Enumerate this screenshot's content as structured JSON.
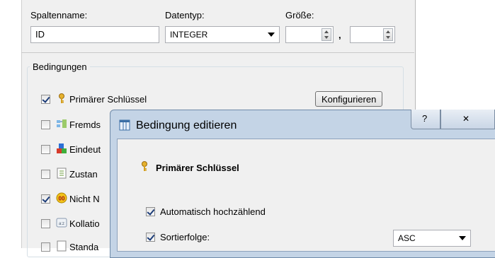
{
  "column": {
    "name_label": "Spaltenname:",
    "name_value": "ID",
    "type_label": "Datentyp:",
    "type_value": "INTEGER",
    "size_label": "Größe:",
    "size_separator": ","
  },
  "constraints": {
    "group_label": "Bedingungen",
    "configure_label": "Konfigurieren",
    "items": [
      {
        "label": "Primärer Schlüssel",
        "checked": true,
        "icon": "key-icon"
      },
      {
        "label": "Fremds",
        "checked": false,
        "icon": "foreign-key-icon"
      },
      {
        "label": "Eindeut",
        "checked": false,
        "icon": "unique-icon"
      },
      {
        "label": "Zustan",
        "checked": false,
        "icon": "check-condition-icon"
      },
      {
        "label": "Nicht N",
        "checked": true,
        "icon": "not-null-icon"
      },
      {
        "label": "Kollatio",
        "checked": false,
        "icon": "collation-icon"
      },
      {
        "label": "Standa",
        "checked": false,
        "icon": "default-icon"
      }
    ]
  },
  "dialog": {
    "title": "Bedingung editieren",
    "help_glyph": "?",
    "close_glyph": "✕",
    "heading": "Primärer Schlüssel",
    "autoincrement_label": "Automatisch hochzählend",
    "autoincrement_checked": true,
    "sort_label": "Sortierfolge:",
    "sort_checked": true,
    "sort_value": "ASC"
  }
}
